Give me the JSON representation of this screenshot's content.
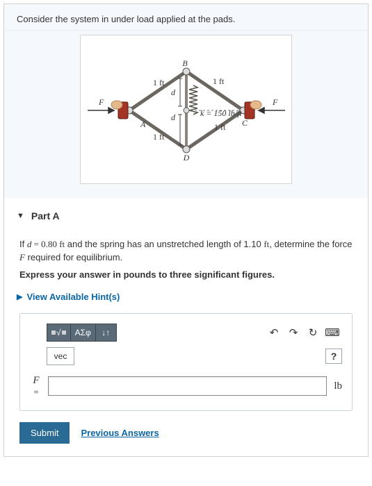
{
  "problem": {
    "statement": "Consider the system in under load applied at the pads."
  },
  "figure": {
    "labelB": "B",
    "labelD": "D",
    "labelA": "A",
    "labelC": "C",
    "labelF_left": "F",
    "labelF_right": "F",
    "len_tl": "1 ft",
    "len_tr": "1 ft",
    "len_bl": "1 ft",
    "len_br": "1 ft",
    "d_top": "d",
    "d_bot": "d",
    "spring_k": "k = 150 lb/ft"
  },
  "partA": {
    "title": "Part A",
    "question_prefix": "If ",
    "d_expr": "d",
    "d_val": " = 0.80 ",
    "d_unit": "ft",
    "question_mid": " and the spring has an unstretched length of 1.10 ",
    "unstr_unit": "ft",
    "question_end": ", determine the force ",
    "force_sym": "F",
    "question_tail": " required for equilibrium.",
    "instruction": "Express your answer in pounds to three significant figures.",
    "hints_label": "View Available Hint(s)"
  },
  "toolbar": {
    "tmpl": "x√",
    "greek": "ΑΣφ",
    "arrows": "↓↑",
    "vec": "vec",
    "undo": "↶",
    "redo": "↷",
    "reset": "↻",
    "keyboard": "⌨",
    "help": "?"
  },
  "answer": {
    "lhs": "F",
    "eq": "=",
    "value": "",
    "unit": "lb"
  },
  "actions": {
    "submit": "Submit",
    "previous": "Previous Answers"
  }
}
